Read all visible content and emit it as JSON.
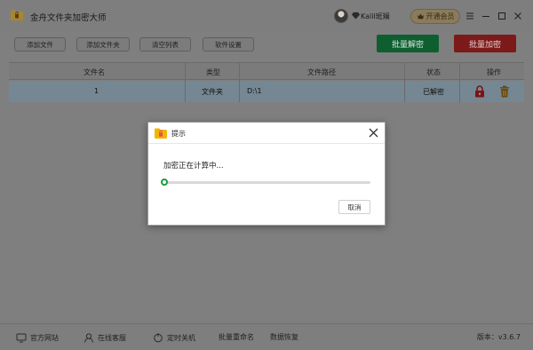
{
  "window": {
    "title": "金舟文件夹加密大师",
    "user_name": "Kalil斑斓",
    "member_button": "开通会员"
  },
  "toolbar": {
    "add_file": "添加文件",
    "add_folder": "添加文件夹",
    "clear_list": "清空列表",
    "settings": "软件设置",
    "batch_decrypt": "批量解密",
    "batch_encrypt": "批量加密"
  },
  "table": {
    "columns": [
      "文件名",
      "类型",
      "文件路径",
      "状态",
      "操作"
    ],
    "rows": [
      {
        "name": "1",
        "type": "文件夹",
        "path": "D:\\1",
        "status": "已解密"
      }
    ]
  },
  "dialog": {
    "title": "提示",
    "message": "加密正在计算中...",
    "progress": 0,
    "cancel_label": "取消"
  },
  "footer": {
    "official_site": "官方网站",
    "online_support": "在线客服",
    "scheduled_shutdown": "定时关机",
    "batch_rename": "批量重命名",
    "data_recovery": "数据恢复",
    "version": "版本：v3.6.7"
  },
  "colors": {
    "accent_green": "#1b9b3c",
    "decrypt_button": "#0e5e30",
    "encrypt_button": "#7c1a1a",
    "selected_row": "#758792"
  }
}
